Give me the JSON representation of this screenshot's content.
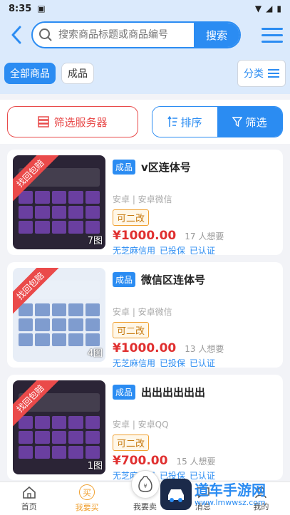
{
  "status_bar": {
    "time": "8:35"
  },
  "header": {
    "search_placeholder": "搜索商品标题或商品编号",
    "search_button": "搜索"
  },
  "tags": {
    "all": "全部商品",
    "finished": "成品",
    "category": "分类"
  },
  "filters": {
    "server": "筛选服务器",
    "sort": "排序",
    "filter": "筛选"
  },
  "items": [
    {
      "ribbon": "找回包赔",
      "image_count": "7图",
      "badge": "成品",
      "title": "v区连体号",
      "platform": "安卓 | 安卓微信",
      "tag": "可二改",
      "price": "¥1000.00",
      "want": "17 人想要",
      "features": [
        "无芝麻信用",
        "已投保",
        "已认证"
      ]
    },
    {
      "ribbon": "找回包赔",
      "image_count": "4图",
      "badge": "成品",
      "title": "微信区连体号",
      "platform": "安卓 | 安卓微信",
      "tag": "可二改",
      "price": "¥1000.00",
      "want": "13 人想要",
      "features": [
        "无芝麻信用",
        "已投保",
        "已认证"
      ]
    },
    {
      "ribbon": "找回包赔",
      "image_count": "1图",
      "badge": "成品",
      "title": "出出出出出出",
      "platform": "安卓 | 安卓QQ",
      "tag": "可二改",
      "price": "¥700.00",
      "want": "15 人想要",
      "features": [
        "无芝麻信用",
        "已投保",
        "已认证"
      ]
    }
  ],
  "tabbar": {
    "home": "首页",
    "buy": "我要买",
    "sell": "我要卖",
    "message": "消息",
    "mine": "我的"
  },
  "watermark": {
    "main": "道车手游网",
    "sub": "www.lmwwsz.com"
  },
  "colors": {
    "primary": "#2b8cf2",
    "danger": "#e84b4b",
    "accent": "#f0a030"
  }
}
